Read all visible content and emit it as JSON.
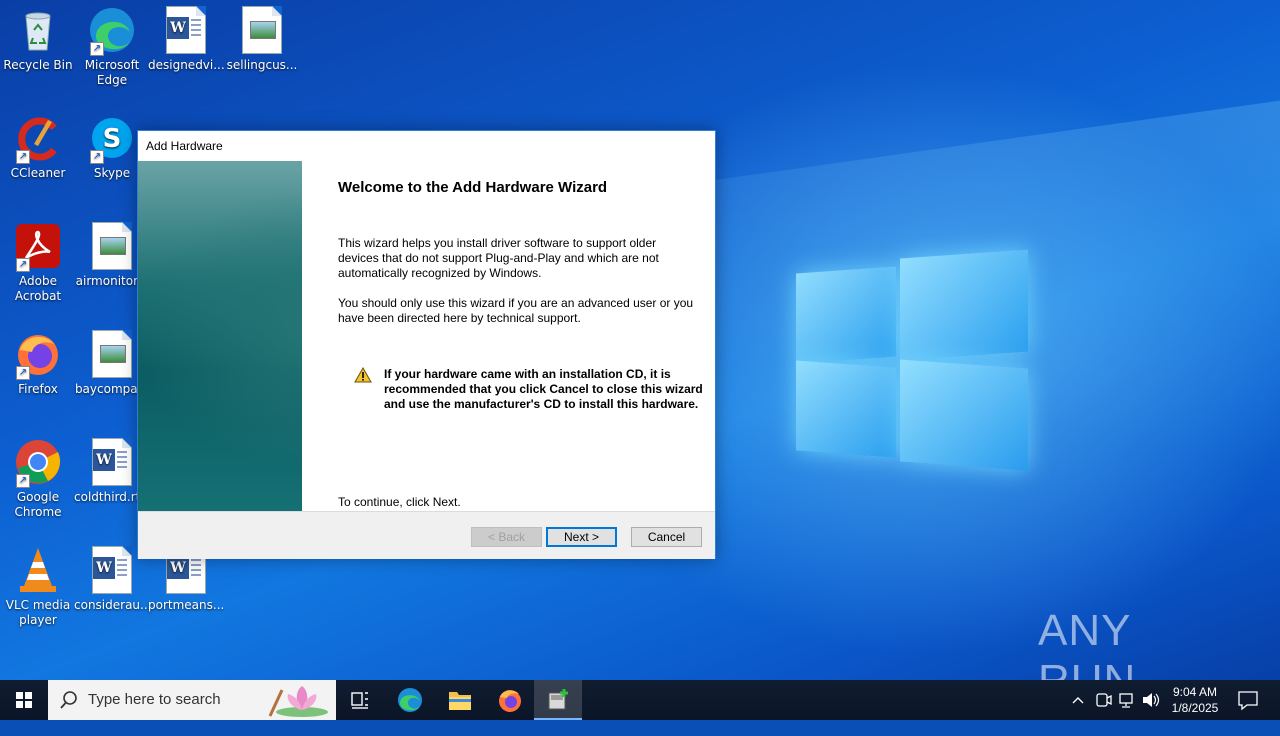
{
  "desktop": {
    "icons": [
      {
        "label": "Recycle Bin"
      },
      {
        "label": "Microsoft Edge"
      },
      {
        "label": "designedvi..."
      },
      {
        "label": "sellingcus..."
      },
      {
        "label": "CCleaner"
      },
      {
        "label": "Skype"
      },
      {
        "label": "Adobe Acrobat"
      },
      {
        "label": "airmonitor..."
      },
      {
        "label": "Firefox"
      },
      {
        "label": "baycompa..."
      },
      {
        "label": "Google Chrome"
      },
      {
        "label": "coldthird.rt..."
      },
      {
        "label": "VLC media player"
      },
      {
        "label": "considerau..."
      },
      {
        "label": "portmeans..."
      }
    ]
  },
  "dialog": {
    "title": "Add Hardware",
    "heading": "Welcome to the Add Hardware Wizard",
    "para1": "This wizard helps you install driver software to support older devices that do not support Plug-and-Play and which are not automatically recognized by Windows.",
    "para2": "You should only use this wizard if you are an advanced user or you have been directed here by technical support.",
    "warning": "If your hardware came with an installation CD, it is recommended that you click Cancel to close this wizard and use the manufacturer's CD to install this hardware.",
    "continue": "To continue, click Next.",
    "buttons": {
      "back": "< Back",
      "next": "Next >",
      "cancel": "Cancel"
    }
  },
  "taskbar": {
    "search_placeholder": "Type here to search",
    "time": "9:04 AM",
    "date": "1/8/2025"
  },
  "watermark": "ANY RUN",
  "colors": {
    "accent": "#0078d7",
    "desktop": "#0d5ed0",
    "taskbar": "#0b1527"
  }
}
